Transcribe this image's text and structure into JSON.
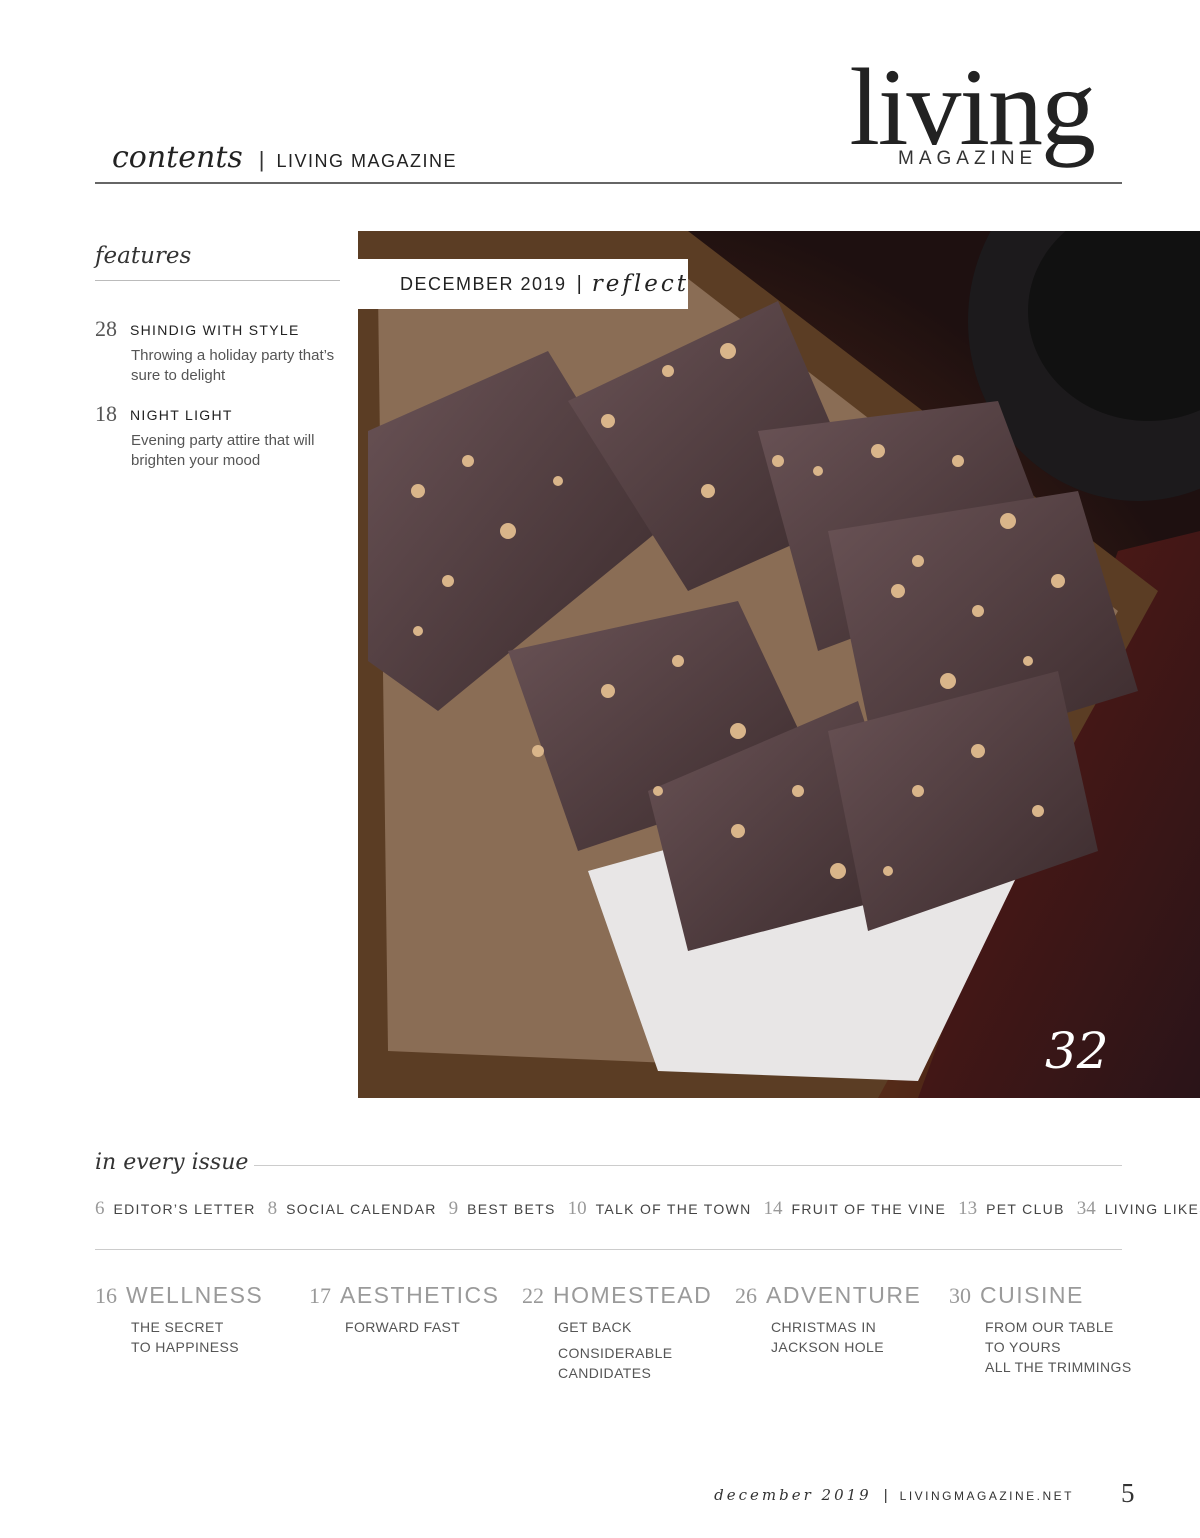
{
  "logo": {
    "word": "living",
    "sub": "MAGAZINE"
  },
  "header": {
    "contents": "contents",
    "separator": "|",
    "brand": "LIVING MAGAZINE"
  },
  "features": {
    "title": "features",
    "items": [
      {
        "page": "28",
        "title": "SHINDIG WITH STYLE",
        "description": "Throwing a holiday party that’s sure to delight"
      },
      {
        "page": "18",
        "title": "NIGHT LIGHT",
        "description": "Evening party attire that will brighten your mood"
      }
    ]
  },
  "cover": {
    "date": "DECEMBER 2019",
    "separator": "|",
    "word": "reflect",
    "page": "32"
  },
  "in_every_issue": {
    "title": "in every issue",
    "items": [
      {
        "page": "6",
        "label": "EDITOR’S LETTER"
      },
      {
        "page": "8",
        "label": "SOCIAL CALENDAR"
      },
      {
        "page": "9",
        "label": "BEST BETS"
      },
      {
        "page": "10",
        "label": "TALK OF THE TOWN"
      },
      {
        "page": "14",
        "label": "FRUIT OF THE VINE"
      },
      {
        "page": "13",
        "label": "PET CLUB"
      },
      {
        "page": "34",
        "label": "LIVING LIKES"
      }
    ]
  },
  "sections": [
    {
      "page": "16",
      "title": "WELLNESS",
      "groups": [
        [
          "THE SECRET",
          "TO HAPPINESS"
        ]
      ]
    },
    {
      "page": "17",
      "title": "AESTHETICS",
      "groups": [
        [
          "FORWARD FAST"
        ]
      ]
    },
    {
      "page": "22",
      "title": "HOMESTEAD",
      "groups": [
        [
          "GET BACK"
        ],
        [
          "CONSIDERABLE",
          "CANDIDATES"
        ]
      ]
    },
    {
      "page": "26",
      "title": "ADVENTURE",
      "groups": [
        [
          "CHRISTMAS IN",
          "JACKSON HOLE"
        ]
      ]
    },
    {
      "page": "30",
      "title": "CUISINE",
      "groups": [
        [
          "FROM OUR TABLE",
          "TO YOURS",
          "ALL THE TRIMMINGS"
        ]
      ]
    }
  ],
  "footer": {
    "month": "december 2019",
    "separator": "|",
    "site": "LIVINGMAGAZINE.NET",
    "page": "5"
  }
}
